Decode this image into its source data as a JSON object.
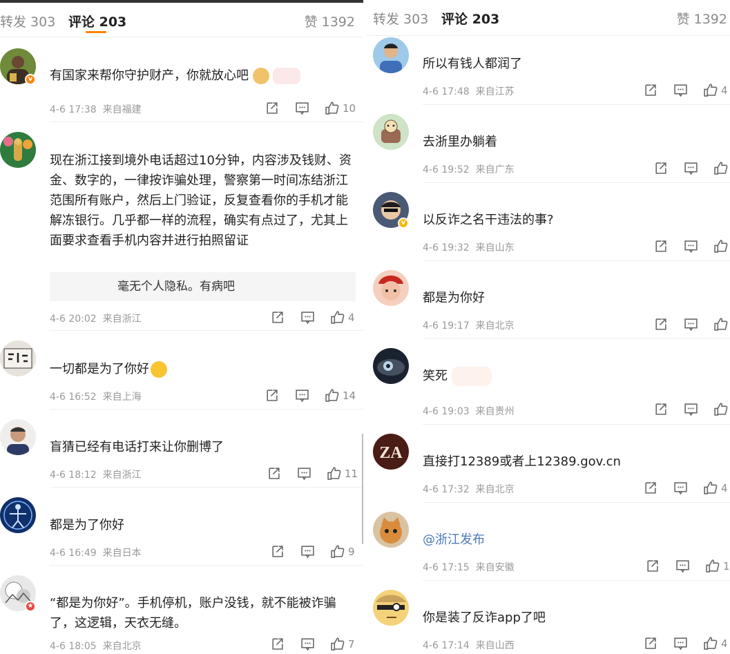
{
  "tabs": {
    "repost": "转发 303",
    "comments": "评论 203",
    "likes": "赞 1392"
  },
  "colors": {
    "accent": "#ff8200",
    "link": "#4a79b8",
    "verified_orange": "#ff8200",
    "verified_yellow": "#f5b800",
    "verified_red": "#e8453c"
  },
  "left_comments": [
    {
      "text": "有国家来帮你守护财产，你就放心吧",
      "time": "4-6 17:38",
      "location": "来自福建",
      "likes": "10",
      "icons": {
        "share": "share-icon",
        "comment": "comment-icon",
        "like": "like-icon"
      }
    },
    {
      "text": "现在浙江接到境外电话超过10分钟，内容涉及钱财、资金、数字的，一律按诈骗处理，警察第一时间冻结浙江范围所有账户，然后上门验证，反复查看你的手机才能解冻银行。几乎都一样的流程，确实有点过了，尤其上面要求查看手机内容并进行拍照留证",
      "reply": "毫无个人隐私。有病吧",
      "time": "4-6 20:02",
      "location": "来自浙江",
      "likes": "4"
    },
    {
      "text": "一切都是为了你好",
      "time": "4-6 16:52",
      "location": "来自上海",
      "likes": "14"
    },
    {
      "text": "盲猜已经有电话打来让你删博了",
      "time": "4-6 18:12",
      "location": "来自浙江",
      "likes": "11"
    },
    {
      "text": "都是为了你好",
      "time": "4-6 16:49",
      "location": "来自日本",
      "likes": "9"
    },
    {
      "text": "“都是为你好”。手机停机，账户没钱，就不能被诈骗了，这逻辑，天衣无缝。",
      "time": "4-6 18:05",
      "location": "来自北京",
      "likes": "7"
    }
  ],
  "right_comments": [
    {
      "text": "所以有钱人都润了",
      "time": "4-6 17:48",
      "location": "来自江苏",
      "likes": "4"
    },
    {
      "text": "去浙里办躺着",
      "time": "4-6 19:52",
      "location": "来自广东",
      "likes": ""
    },
    {
      "text": "以反诈之名干违法的事?",
      "time": "4-6 19:32",
      "location": "来自山东",
      "likes": ""
    },
    {
      "text": "都是为你好",
      "time": "4-6 19:17",
      "location": "来自北京",
      "likes": ""
    },
    {
      "text": "笑死",
      "time": "4-6 19:03",
      "location": "来自贵州",
      "likes": ""
    },
    {
      "text": "直接打12389或者上12389.gov.cn",
      "time": "4-6 17:32",
      "location": "来自北京",
      "likes": "4",
      "avatar_text": "ZA"
    },
    {
      "text": "@浙江发布",
      "time": "4-6 17:15",
      "location": "来自安徽",
      "likes": "1"
    },
    {
      "text": "你是装了反诈app了吧",
      "time": "4-6 17:14",
      "location": "来自山西",
      "likes": "4"
    }
  ]
}
